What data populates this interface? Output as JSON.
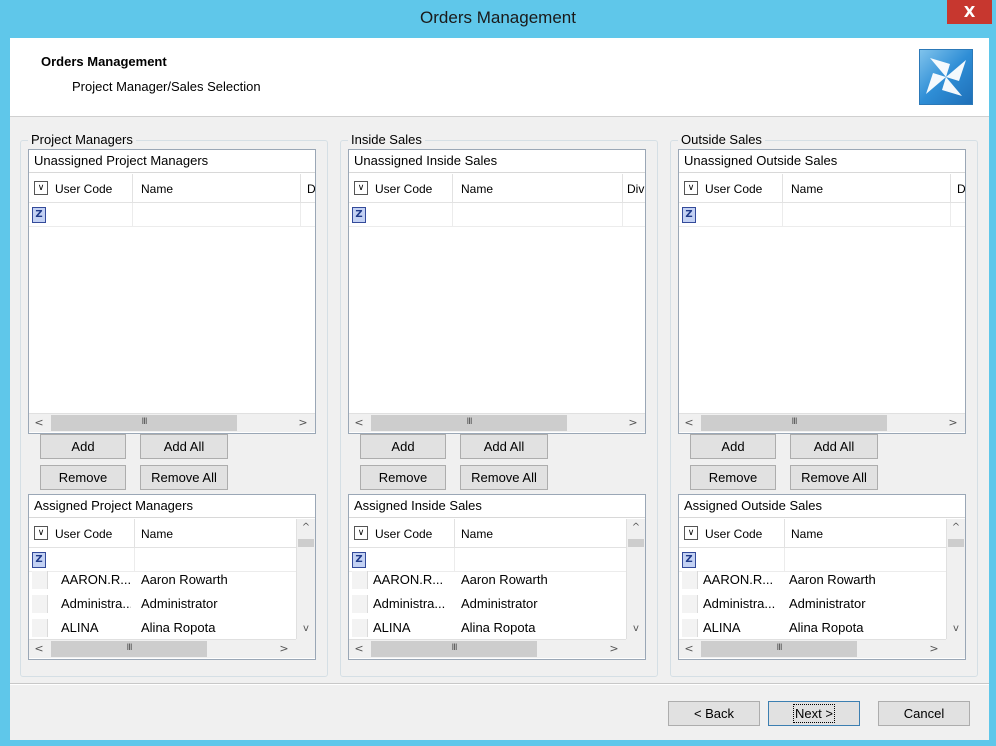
{
  "window": {
    "title": "Orders Management",
    "close_label": "X"
  },
  "header": {
    "title": "Orders Management",
    "subtitle": "Project Manager/Sales Selection"
  },
  "columns": {
    "user_code": "User Code",
    "name": "Name",
    "third_partial_pm": "D",
    "third_partial_is": "Div",
    "third_partial_os": "D"
  },
  "panels": [
    {
      "legend": "Project Managers",
      "unassigned_caption": "Unassigned Project Managers",
      "assigned_caption": "Assigned Project Managers",
      "add_label": "Add",
      "add_all_label": "Add All",
      "remove_label": "Remove",
      "remove_all_label": "Remove All"
    },
    {
      "legend": "Inside Sales",
      "unassigned_caption": "Unassigned Inside Sales",
      "assigned_caption": "Assigned Inside Sales",
      "add_label": "Add",
      "add_all_label": "Add All",
      "remove_label": "Remove",
      "remove_all_label": "Remove All"
    },
    {
      "legend": "Outside Sales",
      "unassigned_caption": "Unassigned Outside Sales",
      "assigned_caption": "Assigned Outside Sales",
      "add_label": "Add",
      "add_all_label": "Add All",
      "remove_label": "Remove",
      "remove_all_label": "Remove All"
    }
  ],
  "assigned_rows": [
    {
      "code": "AARON.R...",
      "name": "Aaron Rowarth"
    },
    {
      "code": "Administra...",
      "name": "Administrator"
    },
    {
      "code": "ALINA",
      "name": "Alina Ropota"
    }
  ],
  "scroll": {
    "left_arrow": "<",
    "right_arrow": ">",
    "up_arrow": "^",
    "down_arrow": "v",
    "grip": "III"
  },
  "footer": {
    "back_label": "< Back",
    "next_label": "Next >",
    "cancel_label": "Cancel"
  },
  "colors": {
    "frame": "#5fc7ea",
    "close": "#c7372f",
    "client": "#f0f0f0"
  }
}
